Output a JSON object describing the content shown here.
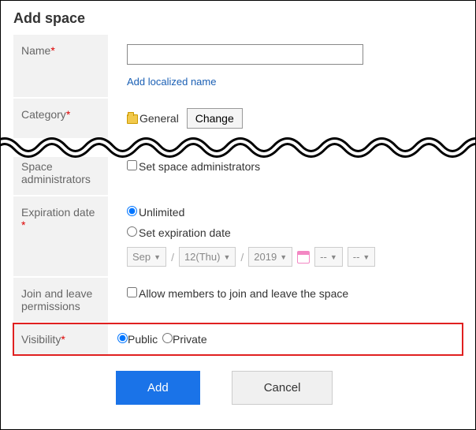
{
  "title": "Add space",
  "fields": {
    "name": {
      "label": "Name",
      "value": "",
      "add_localized_link": "Add localized name"
    },
    "category": {
      "label": "Category",
      "value": "General",
      "change_btn": "Change"
    },
    "admins": {
      "label": "Space administrators",
      "checkbox_label": "Set space administrators",
      "checked": false
    },
    "expiration": {
      "label": "Expiration date ",
      "option_unlimited": "Unlimited",
      "option_set": "Set expiration date",
      "selected": "unlimited",
      "month": "Sep",
      "day": "12(Thu)",
      "year": "2019",
      "hour": "--",
      "minute": "--"
    },
    "join": {
      "label": "Join and leave permissions",
      "checkbox_label": "Allow members to join and leave the space",
      "checked": false
    },
    "visibility": {
      "label": "Visibility",
      "option_public": "Public",
      "option_private": "Private",
      "selected": "public"
    }
  },
  "actions": {
    "submit": "Add",
    "cancel": "Cancel"
  }
}
